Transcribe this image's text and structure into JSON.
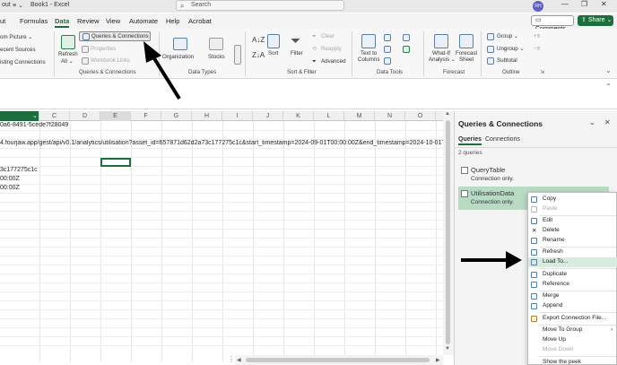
{
  "titlebar": {
    "left_text": "out",
    "arrows": "≡ ⌄",
    "doc_title": "Book1 - Excel",
    "search_placeholder": "Search",
    "avatar": "RH",
    "minimize": "—",
    "restore": "❐",
    "close": "✕"
  },
  "menu": {
    "tabs": [
      {
        "label": "ut"
      },
      {
        "label": "Formulas"
      },
      {
        "label": "Data"
      },
      {
        "label": "Review"
      },
      {
        "label": "View"
      },
      {
        "label": "Automate"
      },
      {
        "label": "Help"
      },
      {
        "label": "Acrobat"
      }
    ],
    "active_tab": "Data",
    "comments_label": "Comments",
    "share_label": "Share"
  },
  "ribbon": {
    "get_data_items": [
      "om Picture ⌄",
      "ecent Sources",
      "isting Connections"
    ],
    "refresh_all": "Refresh",
    "refresh_all2": "All ⌄",
    "queries_connections": "Queries & Connections",
    "properties": "Properties",
    "workbook_links": "Workbook Links",
    "group_queries": "Queries & Connections",
    "organization": "Organization",
    "stocks": "Stocks",
    "group_datatypes": "Data Types",
    "sort": "Sort",
    "filter": "Filter",
    "clear": "Clear",
    "reapply": "Reapply",
    "advanced": "Advanced",
    "group_sortfilter": "Sort & Filter",
    "text_to_columns": "Text to",
    "text_to_columns2": "Columns",
    "group_datatools": "Data Tools",
    "whatif": "What-If",
    "whatif2": "Analysis ⌄",
    "forecast": "Forecast",
    "forecast2": "Sheet",
    "group_forecast": "Forecast",
    "group_btn": "Group ⌄",
    "ungroup_btn": "Ungroup ⌄",
    "subtotal_btn": "Subtotal",
    "group_outline": "Outline"
  },
  "grid": {
    "columns": [
      "C",
      "D",
      "E",
      "F",
      "G",
      "H",
      "I",
      "J",
      "K",
      "L",
      "M",
      "N",
      "O"
    ],
    "row1": "0a6-8491-5cede7f28049",
    "row2": "4.fourjaw.app/gest/api/v0.1/analytics/utilisation?asset_id=657871d62d2a73c177275c1c&start_timestamp=2024-09-01T00:00:00Z&end_timestamp=2024-10-01T00",
    "row5": "3c177275c1c",
    "row6": "00:00Z",
    "row7": "00:00Z"
  },
  "panel": {
    "title": "Queries & Connections",
    "tabs": [
      {
        "label": "Queries"
      },
      {
        "label": "Connections"
      }
    ],
    "count": "2 queries",
    "queries": [
      {
        "name": "QueryTable",
        "desc": "Connection only."
      },
      {
        "name": "UtilisationData",
        "desc": "Connection only."
      }
    ]
  },
  "context_menu": {
    "items": [
      {
        "label": "Copy",
        "disabled": false
      },
      {
        "label": "Paste",
        "disabled": true
      },
      {
        "label": "Edit",
        "disabled": false
      },
      {
        "label": "Delete",
        "disabled": false
      },
      {
        "label": "Rename",
        "disabled": false
      },
      {
        "label": "Refresh",
        "disabled": false
      },
      {
        "label": "Load To...",
        "disabled": false
      },
      {
        "label": "Duplicate",
        "disabled": false
      },
      {
        "label": "Reference",
        "disabled": false
      },
      {
        "label": "Merge",
        "disabled": false
      },
      {
        "label": "Append",
        "disabled": false
      },
      {
        "label": "Export Connection File...",
        "disabled": false
      },
      {
        "label": "Move To Group",
        "disabled": false
      },
      {
        "label": "Move Up",
        "disabled": false
      },
      {
        "label": "Move Down",
        "disabled": true
      },
      {
        "label": "Show the peek",
        "disabled": false
      }
    ]
  },
  "colors": {
    "excel_green": "#1d6e3c",
    "selected_query": "#b7dcc3"
  }
}
